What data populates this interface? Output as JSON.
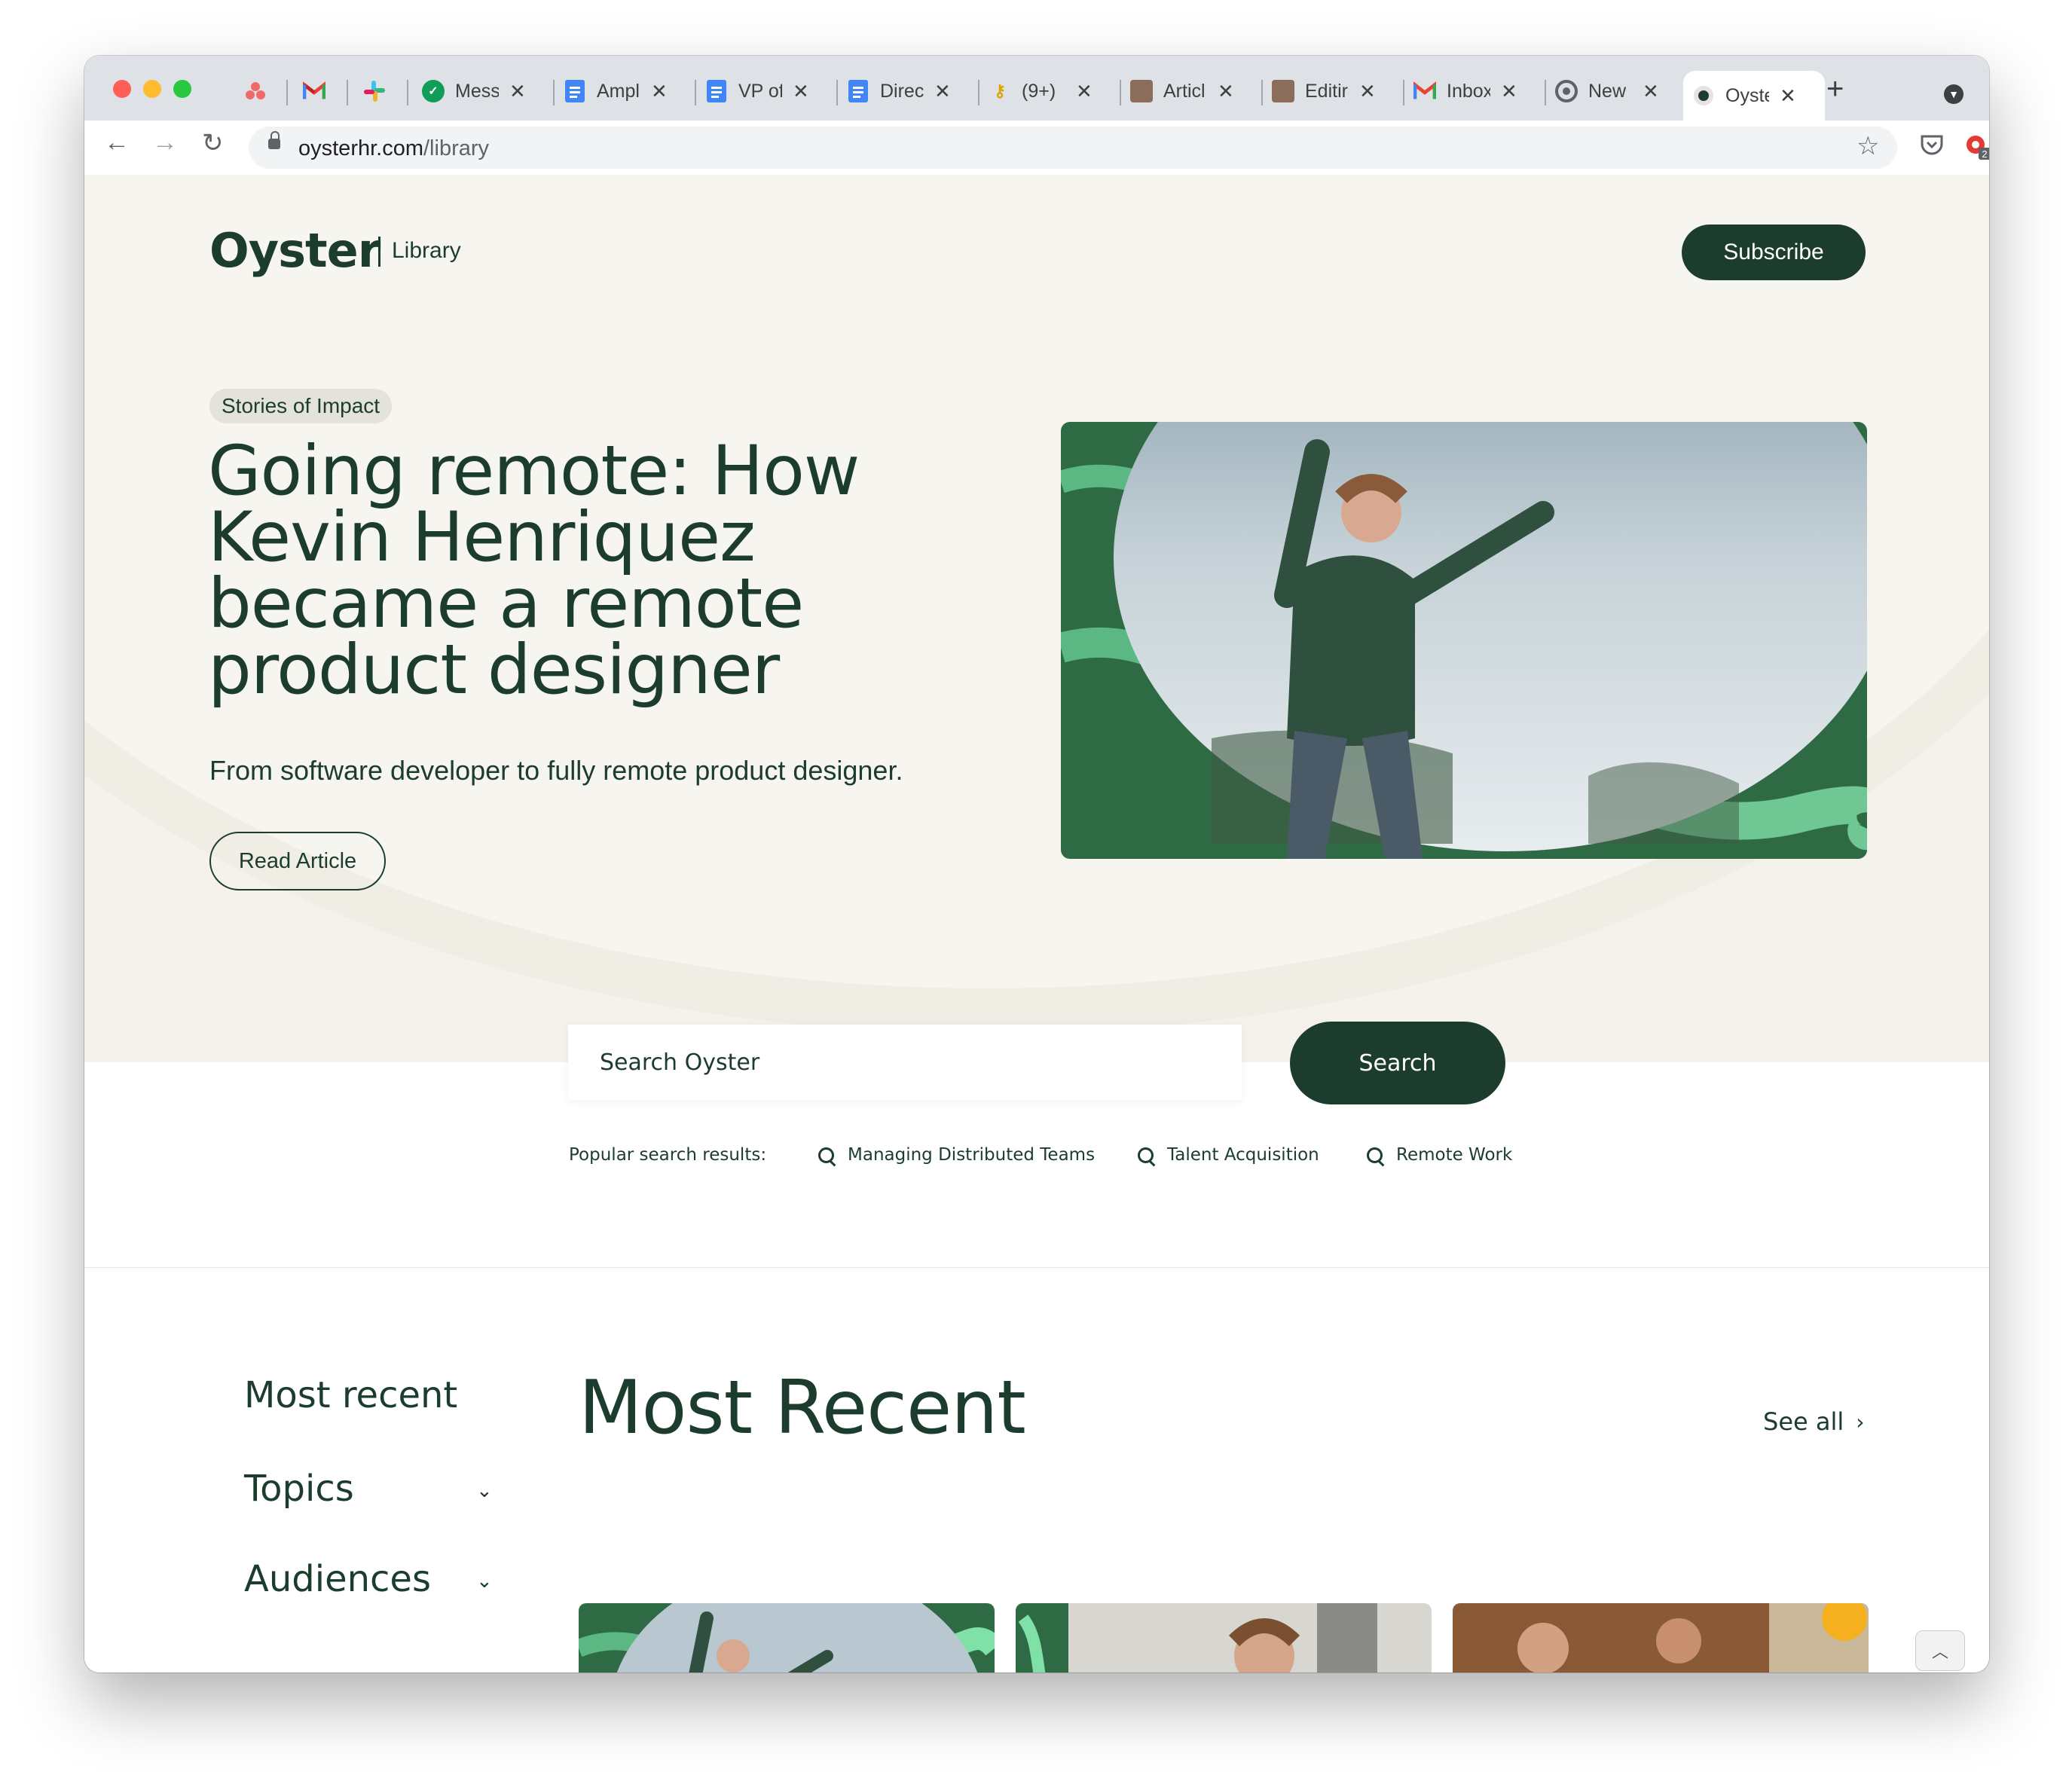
{
  "browser": {
    "tabs": [
      {
        "title": "",
        "icon": "asana-icon"
      },
      {
        "title": "",
        "icon": "gmail-icon"
      },
      {
        "title": "",
        "icon": "slack-icon"
      },
      {
        "title": "Mess",
        "icon": "messenger-icon"
      },
      {
        "title": "Ampl",
        "icon": "docs-icon"
      },
      {
        "title": "VP of",
        "icon": "docs-icon"
      },
      {
        "title": "Direc",
        "icon": "docs-icon"
      },
      {
        "title": "(9+)",
        "icon": "key-icon"
      },
      {
        "title": "Articl",
        "icon": "avatar-icon"
      },
      {
        "title": "Editir",
        "icon": "avatar-icon"
      },
      {
        "title": "Inbox",
        "icon": "gmail-icon"
      },
      {
        "title": "New",
        "icon": "chrome-icon"
      },
      {
        "title": "Oyste",
        "icon": "oyster-icon"
      }
    ],
    "url_host": "oysterhr.com",
    "url_path": "/library",
    "extension_badge": "2"
  },
  "header": {
    "logo": "Oyster",
    "section": "Library",
    "subscribe_label": "Subscribe"
  },
  "hero": {
    "tag": "Stories of Impact",
    "title_lines": [
      "Going remote: How",
      "Kevin Henriquez",
      "became a remote",
      "product designer"
    ],
    "subtitle": "From software developer to fully remote product designer.",
    "read_label": "Read Article"
  },
  "search": {
    "placeholder": "Search Oyster",
    "button_label": "Search",
    "popular_label": "Popular search results:",
    "popular": [
      "Managing Distributed Teams",
      "Talent Acquisition",
      "Remote Work"
    ]
  },
  "sidebar": {
    "items": [
      "Most recent",
      "Topics",
      "Audiences"
    ]
  },
  "recent": {
    "title": "Most Recent",
    "see_all": "See all"
  },
  "colors": {
    "brand_green": "#1c3d2d",
    "accent_green": "#5fcf8e",
    "hero_bg": "#f4f2ea"
  }
}
